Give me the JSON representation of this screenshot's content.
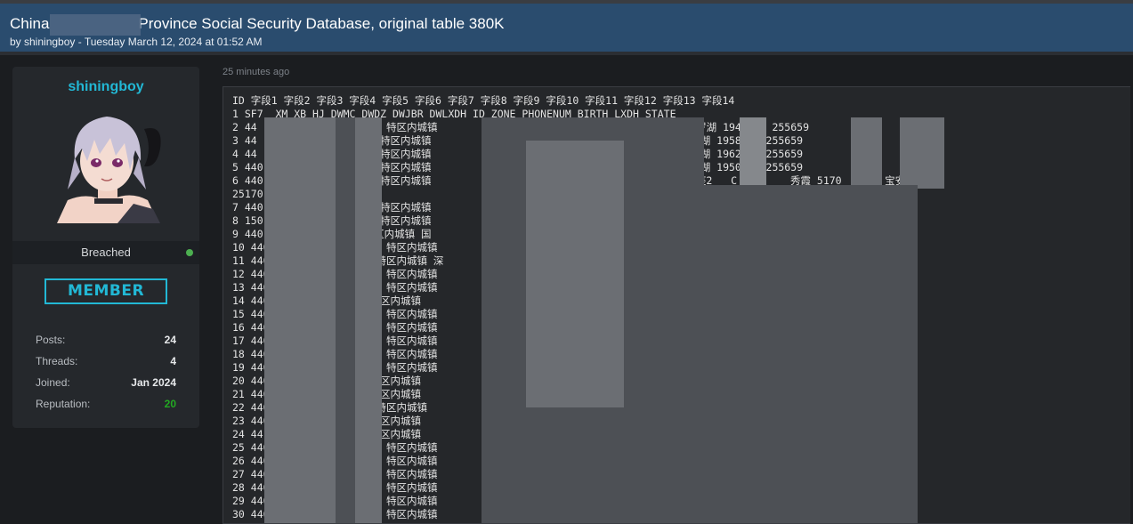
{
  "thread": {
    "title_left": "China",
    "title_right": "Province Social Security Database, original table 380K",
    "byline": "by shiningboy - Tuesday March 12, 2024 at 01:52 AM"
  },
  "author": {
    "username": "shiningboy",
    "status": "Breached",
    "status_color": "#4caf50",
    "rank": "MEMBER",
    "stats": [
      {
        "label": "Posts:",
        "value": "24"
      },
      {
        "label": "Threads:",
        "value": "4"
      },
      {
        "label": "Joined:",
        "value": "Jan 2024"
      },
      {
        "label": "Reputation:",
        "value": "20",
        "color": "#22a822"
      }
    ]
  },
  "post": {
    "time": "25 minutes ago",
    "lines": [
      "ID 字段1 字段2 字段3 字段4 字段5 字段6 字段7 字段8 字段9 字段10 字段11 字段12 字段13 字段14",
      "1 SF7  XM XB HJ DWMC DWDZ DWJBR DWLXDH ID ZONE PHONENUM BIRTH LXDH STATE",
      "2 44       3111 吴  海 男 特区内城镇                   0 6 号 王  玲 2255    1 罗湖 1949    255659",
      "3 44        53 林  汉 男 特区内城镇                   0 6 号 王  玲 2255    2 罗湖 1958    255659",
      "4 44        13 林  爱 男 特区内城镇                   0 6 号 王  玲 2255    3 罗湖 1962    255659",
      "5 440       71 陈  光 男 特区内城镇                   0 6 号 王  玲 2255    4 罗湖 1950    255659",
      "6 440       33 马  水 男 特区内城镇                   石笋岗东路 0 0 2 号 安广场A座2   C D 室    秀霞 5170     5 宝安 1955",
      "25170",
      "7 440        1 林  义 男 特区内城镇                   号外贸大厦  楼 万莉   23086-311 6    1966",
      "8 150        4 刘  琴 女 特区内城镇                   12 7 罗湖 1967 256    12 1",
      "9 440       17 郭  男 特区内城镇 国                   深圳市人民  路天安大厦C座十九楼 马  莉 82485    -5065 8     9 1",
      "10 440      361 张  华 男 特区内城镇                   发展大厦   楼 刘萍  081004 20888   9 罗湖 1    1",
      "11 440      292 孙   女 特区内城镇 深                   号桑达大    7层 孙   83684397    福田 196",
      "12 440      541 赵  坤 男 特区内城镇                   区湖贝路  548号 杨  大厦 谭琼珠   813 2293   11 罗湖   59 1",
      "13 440      563 张  龙 男 特区内城镇                   圳市南山  环路第一工业区机场南侧小萍 26    26 12 南    1963 1",
      "14 440      272 黄  女 特区内城镇                   闻大厦1   1 0 0   饶丽香 209   2 13 196   2090362",
      "15 440      081 谢  文 男 特区内城镇                   汤仲和     9649 14   湖 1956 2554   9 1",
      "16 440      577 王  青 男 特区内城镇                   1 2 号 张  荣 2668    15 南山 19",
      "17 440      131 钟  青 男 特区内城镇                   中路 8 2    屋大厦   何定伟 836    62 16 福    1966 1",
      "18 440      752 王  涛 女 特区内城镇                   军慧 39    30 17 19   83936180 1",
      "19 440      231 张  文 男 特区内城镇                   2239765    1961 82    765 1",
      "20 440      232 张  女 特区内城镇                   39765      1958 82    765 1",
      "21 440      133 廖  男 特区内城镇                   39765      1943 82    765 1",
      "22 440      093 李   男 特区内城镇                   6351 2    954 1",
      "23 440      133 林  男 特区内城镇                   南极路    徐子玲   58826 22 罗    1957 822    26 1",
      "24 44       192 郑  女 特区内城镇                   南极路    徐子玲   58826 23 罗    1956 822    26 1",
      "25 440      191 曹  达 男 特区内城镇                   南极路    徐子玲   58826 24 罗    1963 822    26 1",
      "26 440      131 吕  倩 男 特区内城镇                   229670    5 罗湖 1   82296700 1",
      "27 440      093 黄  雄 男 特区内城镇                   雄 561    9 26 196   5611749 1",
      "28 440      271 谭  灯 男 特区内城镇                   雄 561    9 27 196   5611749 1",
      "29 440      131 李  中 男 特区内城镇                            全    退休人员   企业）                   2    034 1",
      "30 440      315 黄  雄 男 特区内城镇                   2 3 9    林东红 2   788-188028     罗湖 196"
    ]
  }
}
